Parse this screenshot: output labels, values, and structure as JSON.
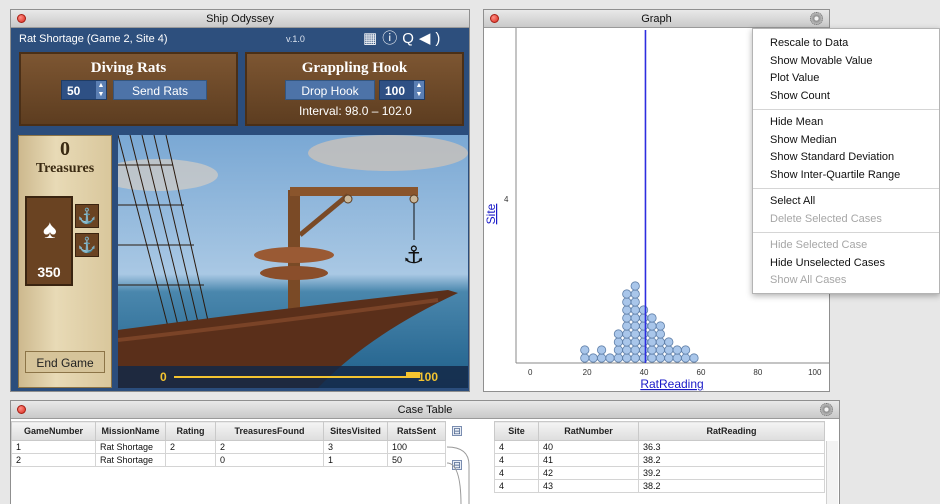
{
  "ship": {
    "window_title": "Ship Odyssey",
    "subtitle": "Rat Shortage  (Game 2, Site 4)",
    "version": "v.1.0",
    "icons": [
      "film-icon",
      "info-icon",
      "search-icon",
      "speaker-icon"
    ],
    "diving_rats": {
      "title": "Diving Rats",
      "count": "50",
      "send_label": "Send Rats"
    },
    "grappling_hook": {
      "title": "Grappling Hook",
      "drop_label": "Drop Hook",
      "depth": "100",
      "interval": "Interval: 98.0 – 102.0"
    },
    "treasures": {
      "count": "0",
      "label": "Treasures"
    },
    "rats_remaining": "350",
    "end_game_label": "End Game",
    "depth_scale": {
      "min": "0",
      "max": "100"
    }
  },
  "graph": {
    "window_title": "Graph",
    "y_axis_label": "Site",
    "y_tick": "4",
    "x_axis_label": "RatReading",
    "x_ticks": [
      "0",
      "20",
      "40",
      "60",
      "80",
      "100"
    ]
  },
  "chart_data": {
    "type": "scatter",
    "title": "",
    "xlabel": "RatReading",
    "ylabel": "Site",
    "xlim": [
      -5,
      105
    ],
    "mean_line_x": 40.5,
    "x": [
      20,
      20,
      21,
      25,
      26,
      27,
      30,
      30,
      31,
      32,
      33,
      33,
      34,
      34,
      34,
      35,
      35,
      35,
      35,
      36,
      36,
      36,
      36.3,
      37,
      37,
      38,
      38,
      38.2,
      38.2,
      39,
      39,
      39.2,
      40,
      40,
      41,
      41,
      42,
      42,
      43,
      43,
      44,
      44,
      45,
      45,
      45,
      46,
      47,
      48,
      49,
      50,
      51,
      52,
      55,
      56,
      58
    ],
    "site": 4
  },
  "menu": {
    "items": [
      {
        "label": "Rescale to Data",
        "enabled": true
      },
      {
        "label": "Show Movable Value",
        "enabled": true
      },
      {
        "label": "Plot Value",
        "enabled": true
      },
      {
        "label": "Show Count",
        "enabled": true
      },
      {
        "label": "Hide Mean",
        "enabled": true
      },
      {
        "label": "Show Median",
        "enabled": true
      },
      {
        "label": "Show Standard Deviation",
        "enabled": true
      },
      {
        "label": "Show Inter-Quartile Range",
        "enabled": true
      },
      {
        "label": "Select All",
        "enabled": true
      },
      {
        "label": "Delete Selected Cases",
        "enabled": false
      },
      {
        "label": "Hide Selected Case",
        "enabled": false
      },
      {
        "label": "Hide Unselected Cases",
        "enabled": true
      },
      {
        "label": "Show All Cases",
        "enabled": false
      }
    ]
  },
  "cases": {
    "window_title": "Case Table",
    "left_columns": [
      "GameNumber",
      "MissionName",
      "Rating",
      "TreasuresFound",
      "SitesVisited",
      "RatsSent"
    ],
    "left_rows": [
      [
        "1",
        "Rat Shortage",
        "2",
        "2",
        "3",
        "100"
      ],
      [
        "2",
        "Rat Shortage",
        "",
        "0",
        "1",
        "50"
      ]
    ],
    "right_columns": [
      "Site",
      "RatNumber",
      "RatReading"
    ],
    "right_rows": [
      [
        "4",
        "40",
        "36.3"
      ],
      [
        "4",
        "41",
        "38.2"
      ],
      [
        "4",
        "42",
        "39.2"
      ],
      [
        "4",
        "43",
        "38.2"
      ]
    ],
    "expander_symbol": "⊟"
  }
}
